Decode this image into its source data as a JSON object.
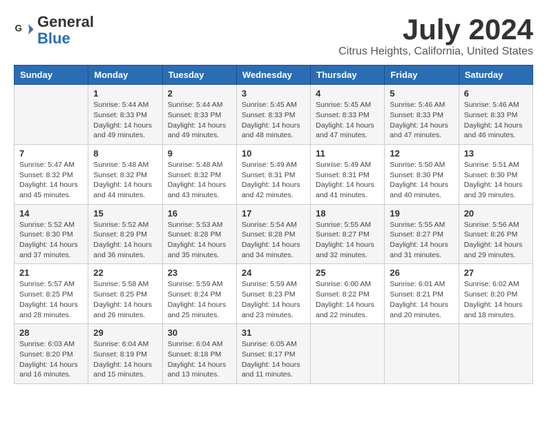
{
  "header": {
    "logo_line1": "General",
    "logo_line2": "Blue",
    "month_title": "July 2024",
    "location": "Citrus Heights, California, United States"
  },
  "days_of_week": [
    "Sunday",
    "Monday",
    "Tuesday",
    "Wednesday",
    "Thursday",
    "Friday",
    "Saturday"
  ],
  "weeks": [
    [
      {
        "day": "",
        "info": ""
      },
      {
        "day": "1",
        "info": "Sunrise: 5:44 AM\nSunset: 8:33 PM\nDaylight: 14 hours\nand 49 minutes."
      },
      {
        "day": "2",
        "info": "Sunrise: 5:44 AM\nSunset: 8:33 PM\nDaylight: 14 hours\nand 49 minutes."
      },
      {
        "day": "3",
        "info": "Sunrise: 5:45 AM\nSunset: 8:33 PM\nDaylight: 14 hours\nand 48 minutes."
      },
      {
        "day": "4",
        "info": "Sunrise: 5:45 AM\nSunset: 8:33 PM\nDaylight: 14 hours\nand 47 minutes."
      },
      {
        "day": "5",
        "info": "Sunrise: 5:46 AM\nSunset: 8:33 PM\nDaylight: 14 hours\nand 47 minutes."
      },
      {
        "day": "6",
        "info": "Sunrise: 5:46 AM\nSunset: 8:33 PM\nDaylight: 14 hours\nand 46 minutes."
      }
    ],
    [
      {
        "day": "7",
        "info": "Sunrise: 5:47 AM\nSunset: 8:32 PM\nDaylight: 14 hours\nand 45 minutes."
      },
      {
        "day": "8",
        "info": "Sunrise: 5:48 AM\nSunset: 8:32 PM\nDaylight: 14 hours\nand 44 minutes."
      },
      {
        "day": "9",
        "info": "Sunrise: 5:48 AM\nSunset: 8:32 PM\nDaylight: 14 hours\nand 43 minutes."
      },
      {
        "day": "10",
        "info": "Sunrise: 5:49 AM\nSunset: 8:31 PM\nDaylight: 14 hours\nand 42 minutes."
      },
      {
        "day": "11",
        "info": "Sunrise: 5:49 AM\nSunset: 8:31 PM\nDaylight: 14 hours\nand 41 minutes."
      },
      {
        "day": "12",
        "info": "Sunrise: 5:50 AM\nSunset: 8:30 PM\nDaylight: 14 hours\nand 40 minutes."
      },
      {
        "day": "13",
        "info": "Sunrise: 5:51 AM\nSunset: 8:30 PM\nDaylight: 14 hours\nand 39 minutes."
      }
    ],
    [
      {
        "day": "14",
        "info": "Sunrise: 5:52 AM\nSunset: 8:30 PM\nDaylight: 14 hours\nand 37 minutes."
      },
      {
        "day": "15",
        "info": "Sunrise: 5:52 AM\nSunset: 8:29 PM\nDaylight: 14 hours\nand 36 minutes."
      },
      {
        "day": "16",
        "info": "Sunrise: 5:53 AM\nSunset: 8:28 PM\nDaylight: 14 hours\nand 35 minutes."
      },
      {
        "day": "17",
        "info": "Sunrise: 5:54 AM\nSunset: 8:28 PM\nDaylight: 14 hours\nand 34 minutes."
      },
      {
        "day": "18",
        "info": "Sunrise: 5:55 AM\nSunset: 8:27 PM\nDaylight: 14 hours\nand 32 minutes."
      },
      {
        "day": "19",
        "info": "Sunrise: 5:55 AM\nSunset: 8:27 PM\nDaylight: 14 hours\nand 31 minutes."
      },
      {
        "day": "20",
        "info": "Sunrise: 5:56 AM\nSunset: 8:26 PM\nDaylight: 14 hours\nand 29 minutes."
      }
    ],
    [
      {
        "day": "21",
        "info": "Sunrise: 5:57 AM\nSunset: 8:25 PM\nDaylight: 14 hours\nand 28 minutes."
      },
      {
        "day": "22",
        "info": "Sunrise: 5:58 AM\nSunset: 8:25 PM\nDaylight: 14 hours\nand 26 minutes."
      },
      {
        "day": "23",
        "info": "Sunrise: 5:59 AM\nSunset: 8:24 PM\nDaylight: 14 hours\nand 25 minutes."
      },
      {
        "day": "24",
        "info": "Sunrise: 5:59 AM\nSunset: 8:23 PM\nDaylight: 14 hours\nand 23 minutes."
      },
      {
        "day": "25",
        "info": "Sunrise: 6:00 AM\nSunset: 8:22 PM\nDaylight: 14 hours\nand 22 minutes."
      },
      {
        "day": "26",
        "info": "Sunrise: 6:01 AM\nSunset: 8:21 PM\nDaylight: 14 hours\nand 20 minutes."
      },
      {
        "day": "27",
        "info": "Sunrise: 6:02 AM\nSunset: 8:20 PM\nDaylight: 14 hours\nand 18 minutes."
      }
    ],
    [
      {
        "day": "28",
        "info": "Sunrise: 6:03 AM\nSunset: 8:20 PM\nDaylight: 14 hours\nand 16 minutes."
      },
      {
        "day": "29",
        "info": "Sunrise: 6:04 AM\nSunset: 8:19 PM\nDaylight: 14 hours\nand 15 minutes."
      },
      {
        "day": "30",
        "info": "Sunrise: 6:04 AM\nSunset: 8:18 PM\nDaylight: 14 hours\nand 13 minutes."
      },
      {
        "day": "31",
        "info": "Sunrise: 6:05 AM\nSunset: 8:17 PM\nDaylight: 14 hours\nand 11 minutes."
      },
      {
        "day": "",
        "info": ""
      },
      {
        "day": "",
        "info": ""
      },
      {
        "day": "",
        "info": ""
      }
    ]
  ]
}
